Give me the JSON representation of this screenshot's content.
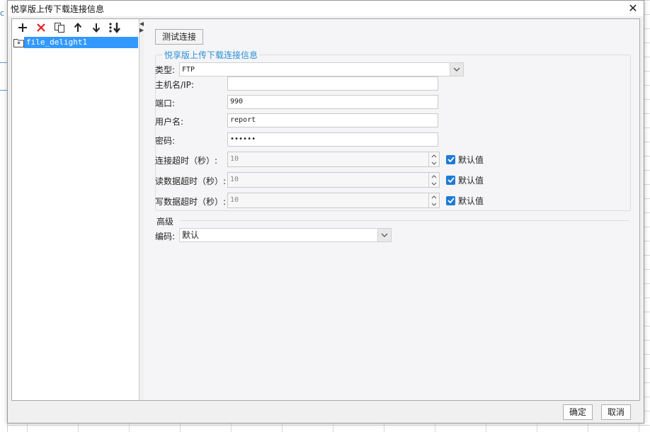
{
  "window": {
    "title": "悦享版上传下载连接信息",
    "close_glyph": "✕"
  },
  "background": {
    "cell_fragment": "c"
  },
  "toolbar": {
    "icons": [
      "add-icon",
      "delete-icon",
      "copy-icon",
      "move-up-icon",
      "move-down-icon",
      "sort-icon"
    ]
  },
  "tree": {
    "items": [
      {
        "label": "file_delight1",
        "icon": "folder-file-icon",
        "selected": true
      }
    ]
  },
  "connection": {
    "test_button": "测试连接",
    "group_title": "悦享版上传下载连接信息",
    "type_label": "类型:",
    "type_value": "FTP",
    "host_label": "主机名/IP:",
    "host_value": "",
    "port_label": "端口:",
    "port_value": "990",
    "user_label": "用户名:",
    "user_value": "report",
    "password_label": "密码:",
    "password_value": "••••••",
    "connect_timeout_label": "连接超时（秒）:",
    "connect_timeout_value": "10",
    "read_timeout_label": "读数据超时（秒）:",
    "read_timeout_value": "10",
    "write_timeout_label": "写数据超时（秒）:",
    "write_timeout_value": "10",
    "default_label": "默认值",
    "default_checked": true
  },
  "advanced": {
    "title": "高级",
    "encoding_label": "编码:",
    "encoding_value": "默认"
  },
  "footer": {
    "ok": "确定",
    "cancel": "取消"
  },
  "colors": {
    "accent": "#2a8fd6",
    "selection": "#3399ff",
    "checkbox": "#1f7bd6",
    "delete_red": "#e02020"
  }
}
